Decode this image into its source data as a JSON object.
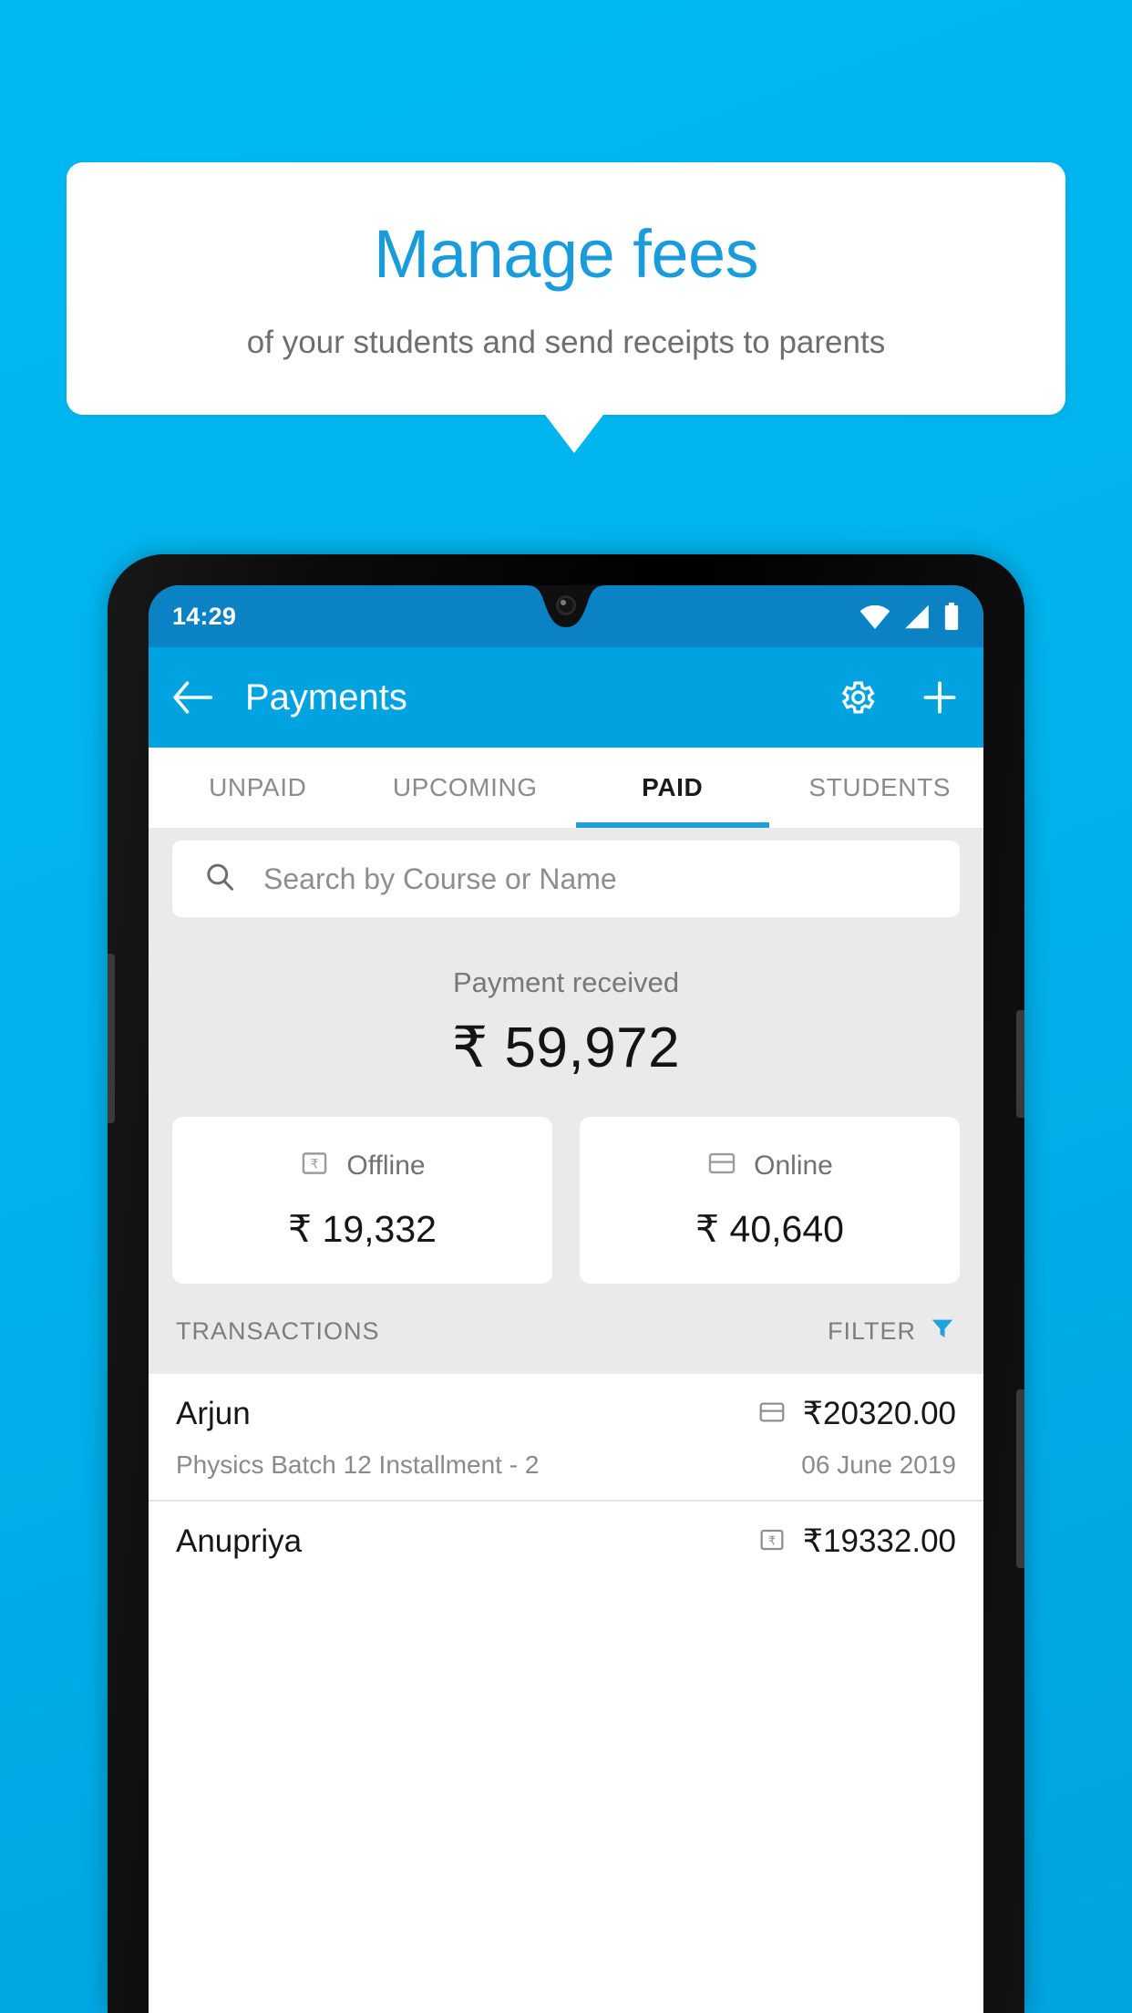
{
  "promo": {
    "title": "Manage fees",
    "subtitle": "of your students and send receipts to parents",
    "accent_color": "#1a9bdc",
    "background_color": "#00b0ef"
  },
  "phone": {
    "statusbar": {
      "time": "14:29",
      "icons": [
        "wifi-icon",
        "cellular-signal-icon",
        "battery-icon"
      ]
    },
    "appbar": {
      "back_icon": "arrow-left-icon",
      "title": "Payments",
      "settings_icon": "gear-icon",
      "add_icon": "plus-icon",
      "color": "#00a3e0"
    },
    "tabs": [
      {
        "label": "UNPAID",
        "active": false
      },
      {
        "label": "UPCOMING",
        "active": false
      },
      {
        "label": "PAID",
        "active": true
      },
      {
        "label": "STUDENTS",
        "active": false
      }
    ],
    "search": {
      "placeholder": "Search by Course or Name",
      "icon": "search-icon",
      "value": ""
    },
    "summary": {
      "label": "Payment received",
      "amount": "₹ 59,972"
    },
    "payment_modes": [
      {
        "label": "Offline",
        "amount": "₹ 19,332",
        "icon": "rupee-note-icon"
      },
      {
        "label": "Online",
        "amount": "₹ 40,640",
        "icon": "credit-card-icon"
      }
    ],
    "transactions_header": {
      "title": "TRANSACTIONS",
      "filter_label": "FILTER",
      "filter_icon": "funnel-icon",
      "filter_icon_color": "#1fa3dd"
    },
    "transactions": [
      {
        "name": "Arjun",
        "amount": "₹20320.00",
        "mode_icon": "credit-card-icon",
        "description": "Physics Batch 12 Installment - 2",
        "date": "06 June 2019"
      },
      {
        "name": "Anupriya",
        "amount": "₹19332.00",
        "mode_icon": "rupee-note-icon",
        "description": "",
        "date": ""
      }
    ]
  }
}
